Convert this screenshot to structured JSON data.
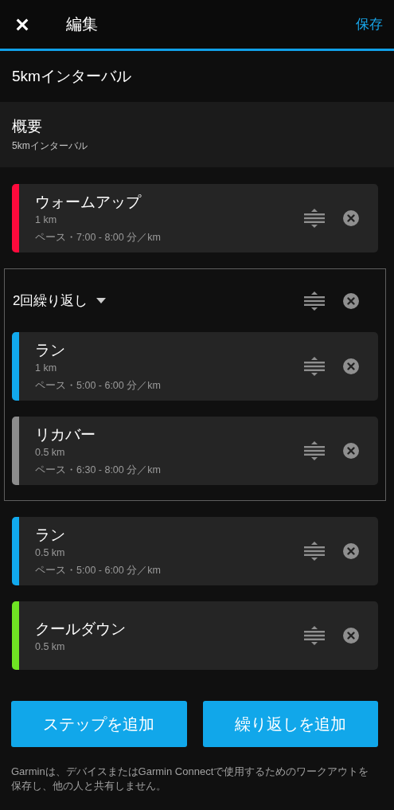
{
  "header": {
    "title": "編集",
    "save": "保存"
  },
  "workout_name": "5kmインターバル",
  "summary": {
    "label": "概要",
    "value": "5kmインターバル"
  },
  "steps": [
    {
      "kind": "step",
      "name": "ウォームアップ",
      "distance": "1 km",
      "pace": "ペース・7:00 - 8:00 分／km",
      "color": "#ff0a3c"
    },
    {
      "kind": "repeat",
      "label": "2回繰り返し",
      "children": [
        {
          "kind": "step",
          "name": "ラン",
          "distance": "1 km",
          "pace": "ペース・5:00 - 6:00 分／km",
          "color": "#11a9ed"
        },
        {
          "kind": "step",
          "name": "リカバー",
          "distance": "0.5 km",
          "pace": "ペース・6:30 - 8:00 分／km",
          "color": "#8c8c8c"
        }
      ]
    },
    {
      "kind": "step",
      "name": "ラン",
      "distance": "0.5 km",
      "pace": "ペース・5:00 - 6:00 分／km",
      "color": "#11a9ed"
    },
    {
      "kind": "step",
      "name": "クールダウン",
      "distance": "0.5 km",
      "color": "#6fe323"
    }
  ],
  "buttons": [
    "ステップを追加",
    "繰り返しを追加"
  ],
  "footer": "Garminは、デバイスまたはGarmin Connectで使用するためのワークアウトを保存し、他の人と共有しません。"
}
